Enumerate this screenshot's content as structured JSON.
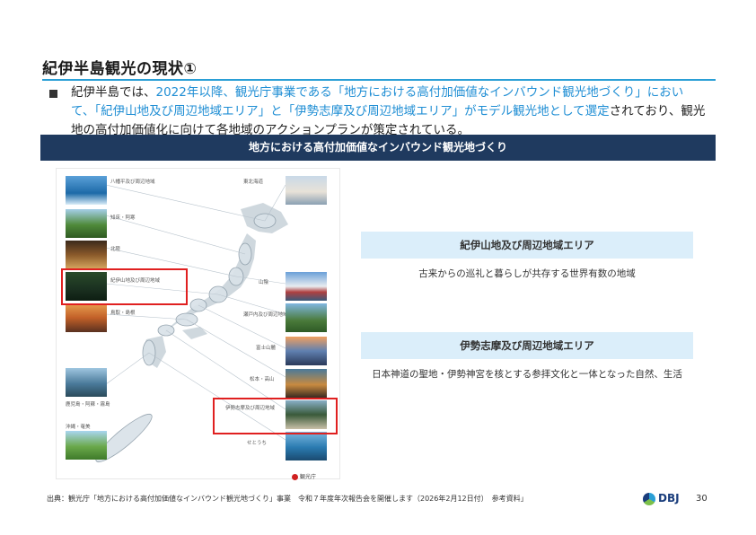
{
  "slide": {
    "title": "紀伊半島観光の現状①",
    "body": {
      "p1": "紀伊半島では、",
      "p2": "2022年以降、観光庁事業である「地方における高付加価値なインバウンド観光地づくり」において、「紀伊山地及び周辺地域エリア」と「伊勢志摩及び周辺地域エリア」がモデル観光地として選定",
      "p3": "されており、観光地の高付加価値化に向けて各地域のアクションプランが策定されている。"
    },
    "banner": "地方における高付加価値なインバウンド観光地づくり"
  },
  "map": {
    "left_labels": [
      "八幡平及び周辺地域",
      "知床・阿寒",
      "北陸",
      "紀伊山地及び周辺地域",
      "鳥取・島根",
      "鹿児島・阿蘇・霧島",
      "沖縄・奄美"
    ],
    "right_labels": [
      "東北海道",
      "山陰",
      "瀬戸内及び周辺地域",
      "富士山麓",
      "松本・高山",
      "伊勢志摩及び周辺地域",
      "せとうち"
    ],
    "agency_logo": "観光庁"
  },
  "areas": [
    {
      "name": "紀伊山地及び周辺地域エリア",
      "desc": "古来からの巡礼と暮らしが共存する世界有数の地域"
    },
    {
      "name": "伊勢志摩及び周辺地域エリア",
      "desc": "日本神道の聖地・伊勢神宮を核とする参拝文化と一体となった自然、生活"
    }
  ],
  "footer": {
    "source": "出典：観光庁「地方における高付加価値なインバウンド観光地づくり」事業　令和７年度年次報告会を開催します（2026年2月12日付）　参考資料」",
    "logo_text": "DBJ",
    "page": "30"
  },
  "colors": {
    "accent": "#2a9fd6",
    "banner": "#1f3a5f",
    "highlight": "#1f8ed4",
    "area_bg": "#dbeefa",
    "red": "#e02020"
  }
}
